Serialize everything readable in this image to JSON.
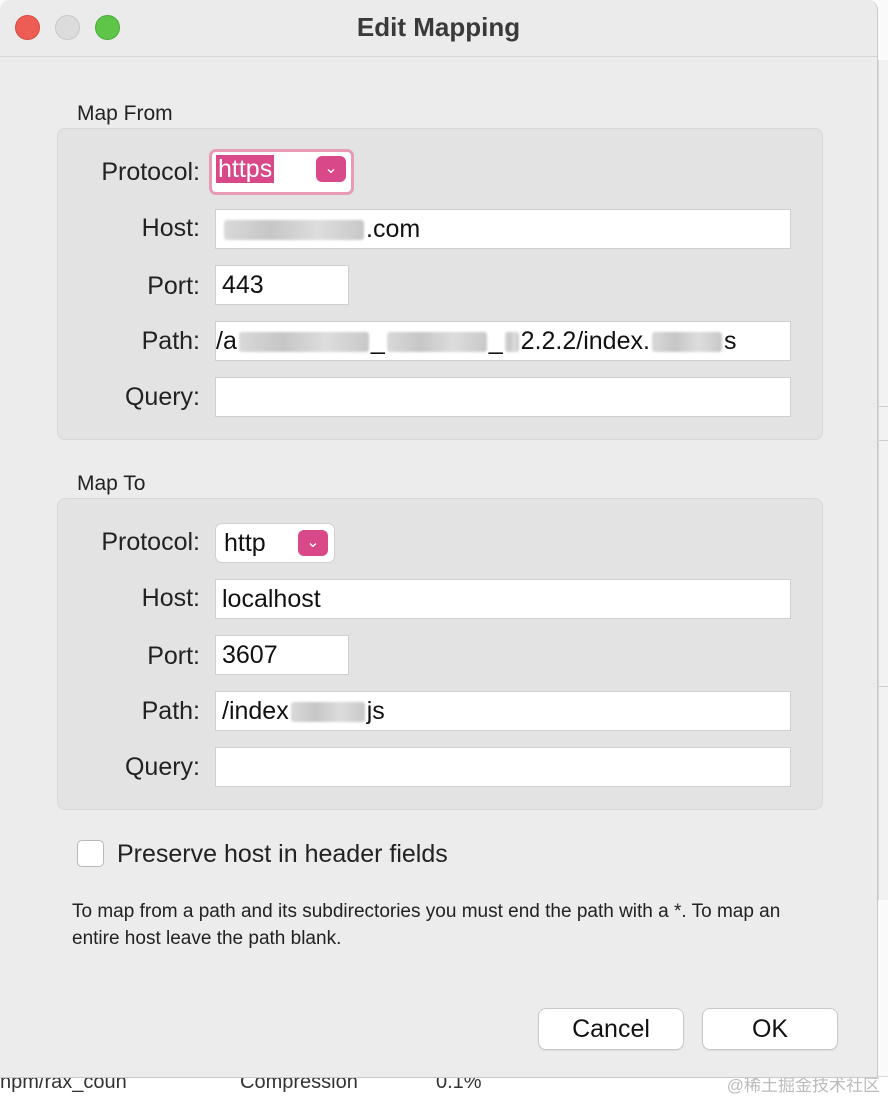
{
  "window": {
    "title": "Edit Mapping"
  },
  "map_from": {
    "section_title": "Map From",
    "protocol_label": "Protocol:",
    "protocol_value": "https",
    "host_label": "Host:",
    "host_value_suffix": ".com",
    "port_label": "Port:",
    "port_value": "443",
    "path_label": "Path:",
    "path_value_prefix": "/a",
    "path_value_mid1": "_",
    "path_value_mid2": "_",
    "path_value_mid3": "2.2.2/index.",
    "path_value_suffix": "s",
    "query_label": "Query:",
    "query_value": ""
  },
  "map_to": {
    "section_title": "Map To",
    "protocol_label": "Protocol:",
    "protocol_value": "http",
    "host_label": "Host:",
    "host_value": "localhost",
    "port_label": "Port:",
    "port_value": "3607",
    "path_label": "Path:",
    "path_value_prefix": "/index",
    "path_value_suffix": "js",
    "query_label": "Query:",
    "query_value": ""
  },
  "options": {
    "preserve_host_label": "Preserve host in header fields",
    "preserve_host_checked": false
  },
  "hint_text": "To map from a path and its subdirectories you must end the path with a *. To map an entire host leave the path blank.",
  "buttons": {
    "cancel": "Cancel",
    "ok": "OK"
  },
  "background": {
    "bottom_text_1": "npm/rax_coun",
    "bottom_text_2": "Compression",
    "bottom_text_3": "0.1%",
    "watermark": "@稀土掘金技术社区"
  },
  "colors": {
    "accent": "#d9498a",
    "focus_ring": "#e79ab6"
  }
}
